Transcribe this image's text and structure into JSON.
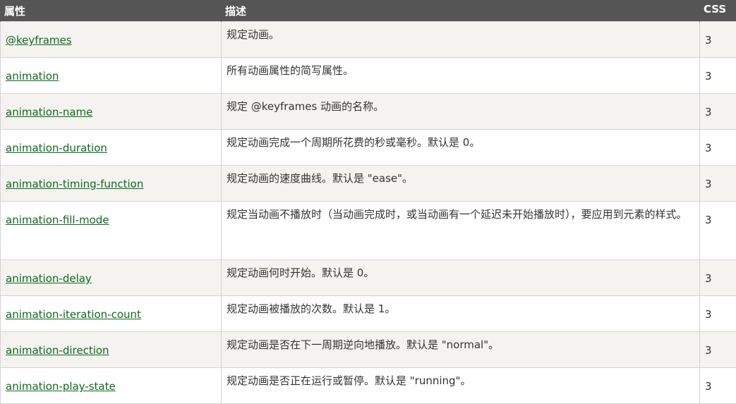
{
  "table": {
    "headers": {
      "property": "属性",
      "description": "描述",
      "css": "CSS"
    },
    "rows": [
      {
        "property": "@keyframes",
        "description": "规定动画。",
        "css": "3"
      },
      {
        "property": "animation",
        "description": "所有动画属性的简写属性。",
        "css": "3"
      },
      {
        "property": "animation-name",
        "description": "规定 @keyframes 动画的名称。",
        "css": "3"
      },
      {
        "property": "animation-duration",
        "description": "规定动画完成一个周期所花费的秒或毫秒。默认是 0。",
        "css": "3"
      },
      {
        "property": "animation-timing-function",
        "description": "规定动画的速度曲线。默认是 \"ease\"。",
        "css": "3"
      },
      {
        "property": "animation-fill-mode",
        "description": "规定当动画不播放时（当动画完成时，或当动画有一个延迟未开始播放时），要应用到元素的样式。",
        "css": "3"
      },
      {
        "property": "animation-delay",
        "description": "规定动画何时开始。默认是 0。",
        "css": "3"
      },
      {
        "property": "animation-iteration-count",
        "description": "规定动画被播放的次数。默认是 1。",
        "css": "3"
      },
      {
        "property": "animation-direction",
        "description": "规定动画是否在下一周期逆向地播放。默认是 \"normal\"。",
        "css": "3"
      },
      {
        "property": "animation-play-state",
        "description": "规定动画是否正在运行或暂停。默认是 \"running\"。",
        "css": "3"
      }
    ]
  },
  "colors": {
    "header_bg": "#555555",
    "link": "#0e6a1f",
    "odd_row_bg": "#f4f3ef",
    "border": "#d4d4d4"
  }
}
